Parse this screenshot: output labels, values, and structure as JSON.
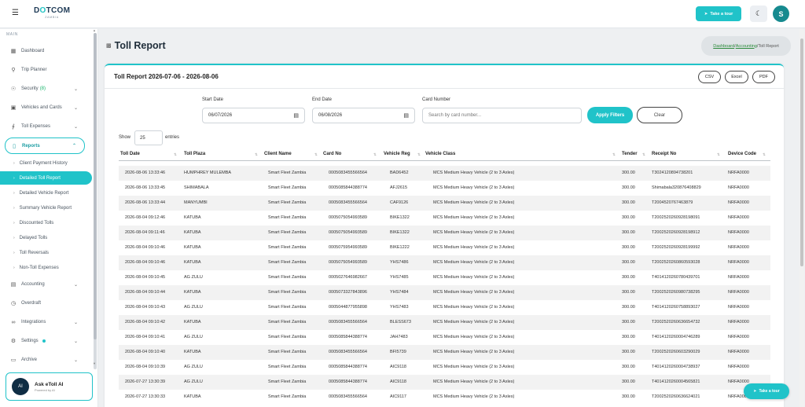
{
  "topbar": {
    "logo_main_a": "D",
    "logo_main_o": "O",
    "logo_main_b": "TCOM",
    "logo_sub": "ZAMBIA",
    "tour_label": "Take a tour",
    "theme_icon": "moon-icon",
    "avatar_initial": "S"
  },
  "sidebar": {
    "section": "MAIN",
    "items": [
      {
        "label": "Dashboard",
        "icon": "dashboard-icon"
      },
      {
        "label": "Trip Planner",
        "icon": "map-pin-icon"
      },
      {
        "label": "Security",
        "badge": "(8)",
        "icon": "shield-icon"
      },
      {
        "label": "Vehicles and Cards",
        "icon": "car-icon"
      },
      {
        "label": "Toll Expenses",
        "icon": "bar-chart-icon"
      },
      {
        "label": "Reports",
        "icon": "folder-icon"
      }
    ],
    "report_subitems": [
      "Client Payment History",
      "Detailed Toll Report",
      "Detailed Vehicle Report",
      "Summary Vehicle Report",
      "Discounted Tolls",
      "Delayed Tolls",
      "Toll Reversals",
      "Non-Toll Expenses"
    ],
    "bottom_items": [
      {
        "label": "Accounting",
        "icon": "book-icon"
      },
      {
        "label": "Overdraft",
        "icon": "clock-icon"
      },
      {
        "label": "Integrations",
        "icon": "link-icon"
      },
      {
        "label": "Settings",
        "icon": "gear-icon"
      },
      {
        "label": "Archive",
        "icon": "archive-icon"
      }
    ],
    "ask": {
      "title": "Ask eToll AI",
      "subtitle": "Powered by AI",
      "logo": "AI"
    }
  },
  "page": {
    "title": "Toll Report",
    "breadcrumb": {
      "dashboard": "Dashboard",
      "accounting": "Accounting",
      "current": "Toll Report",
      "sep": "/"
    }
  },
  "card": {
    "title": "Toll Report 2026-07-06 - 2026-08-06",
    "export_buttons": [
      "CSV",
      "Excel",
      "PDF"
    ]
  },
  "filters": {
    "start_label": "Start Date",
    "start_value": "06/07/2026",
    "end_label": "End Date",
    "end_value": "06/08/2026",
    "card_label": "Card Number",
    "card_placeholder": "Search by card number...",
    "apply_label": "Apply Filters",
    "clear_label": "Clear"
  },
  "table": {
    "show_label": "Show",
    "page_size": "25",
    "entries_label": "entries",
    "columns": [
      "Toll Date",
      "Toll Plaza",
      "Client Name",
      "Card No",
      "Vehicle Reg",
      "Vehicle Class",
      "Tender",
      "Receipt No",
      "Device Code"
    ],
    "rows": [
      [
        "2026-08-06 13:33:46",
        "HUMPHREY MULEMBA",
        "Smart Fleet Zambia",
        "0005083455566564",
        "BAD6452",
        "MCS Medium Heavy Vehicle (2 to 3 Axles)",
        "300.00",
        "T3024120894738201",
        "NRFA0000"
      ],
      [
        "2026-08-06 13:33:45",
        "SHIMABALA",
        "Smart Fleet Zambia",
        "0005085844388774",
        "AFJ2615",
        "MCS Medium Heavy Vehicle (2 to 3 Axles)",
        "300.00",
        "Shimabala320876408829",
        "NRFA0000"
      ],
      [
        "2026-08-06 13:33:44",
        "MANYUMBI",
        "Smart Fleet Zambia",
        "0005083455566564",
        "CAF9126",
        "MCS Medium Heavy Vehicle (2 to 3 Axles)",
        "300.00",
        "T2004520767463879",
        "NRFA0000"
      ],
      [
        "2026-08-04 09:12:46",
        "KATUBA",
        "Smart Fleet Zambia",
        "0005075054993589",
        "BIKE1322",
        "MCS Medium Heavy Vehicle (2 to 3 Axles)",
        "300.00",
        "T2002520260928198091",
        "NRFA0000"
      ],
      [
        "2026-08-04 09:11:46",
        "KATUBA",
        "Smart Fleet Zambia",
        "0005075054993589",
        "BIKE1322",
        "MCS Medium Heavy Vehicle (2 to 3 Axles)",
        "300.00",
        "T2002520260928198912",
        "NRFA0000"
      ],
      [
        "2026-08-04 09:10:46",
        "KATUBA",
        "Smart Fleet Zambia",
        "0005075954993589",
        "BIKE1222",
        "MCS Medium Heavy Vehicle (2 to 3 Axles)",
        "300.00",
        "T2002520260928199992",
        "NRFA0000"
      ],
      [
        "2026-08-04 09:10:46",
        "KATUBA",
        "Smart Fleet Zambia",
        "0005075054993589",
        "YHS7486",
        "MCS Medium Heavy Vehicle (2 to 3 Axles)",
        "300.00",
        "T2002520260860593028",
        "NRFA0000"
      ],
      [
        "2026-08-04 09:10:45",
        "AG ZULU",
        "Smart Fleet Zambia",
        "0005027646982667",
        "YHS7485",
        "MCS Medium Heavy Vehicle (2 to 3 Axles)",
        "300.00",
        "T4014120260780439701",
        "NRFA0000"
      ],
      [
        "2026-08-04 09:10:44",
        "KATUBA",
        "Smart Fleet Zambia",
        "0005073327843896",
        "YHS7484",
        "MCS Medium Heavy Vehicle (2 to 3 Axles)",
        "300.00",
        "T2002520260980738295",
        "NRFA0000"
      ],
      [
        "2026-08-04 09:10:43",
        "AG ZULU",
        "Smart Fleet Zambia",
        "0005044877955898",
        "YHS7483",
        "MCS Medium Heavy Vehicle (2 to 3 Axles)",
        "300.00",
        "T4014120260758893027",
        "NRFA0000"
      ],
      [
        "2026-08-04 09:10:42",
        "KATUBA",
        "Smart Fleet Zambia",
        "0005083455566564",
        "BLESS673",
        "MCS Medium Heavy Vehicle (2 to 3 Axles)",
        "300.00",
        "T2002520260636654732",
        "NRFA0000"
      ],
      [
        "2026-08-04 09:10:41",
        "AG ZULU",
        "Smart Fleet Zambia",
        "0005085844388774",
        "JAH7483",
        "MCS Medium Heavy Vehicle (2 to 3 Axles)",
        "300.00",
        "T4014120260004746289",
        "NRFA0000"
      ],
      [
        "2026-08-04 09:10:40",
        "KATUBA",
        "Smart Fleet Zambia",
        "0005083455566564",
        "BFI5739",
        "MCS Medium Heavy Vehicle (2 to 3 Axles)",
        "300.00",
        "T2002520260603290029",
        "NRFA0000"
      ],
      [
        "2026-08-04 09:10:39",
        "AG ZULU",
        "Smart Fleet Zambia",
        "0005085844388774",
        "AIC9118",
        "MCS Medium Heavy Vehicle (2 to 3 Axles)",
        "300.00",
        "T4014120260004738937",
        "NRFA0000"
      ],
      [
        "2026-07-27 13:30:39",
        "AG ZULU",
        "Smart Fleet Zambia",
        "0005085844388774",
        "AIC9118",
        "MCS Medium Heavy Vehicle (2 to 3 Axles)",
        "300.00",
        "T4014120260004565821",
        "NRFA0000"
      ],
      [
        "2026-07-27 13:30:33",
        "KATUBA",
        "Smart Fleet Zambia",
        "0005083455566564",
        "AIC9117",
        "MCS Medium Heavy Vehicle (2 to 3 Axles)",
        "300.00",
        "T2002520260636624021",
        "NRFA0000"
      ]
    ]
  },
  "fab": {
    "label": "Take a tour"
  }
}
